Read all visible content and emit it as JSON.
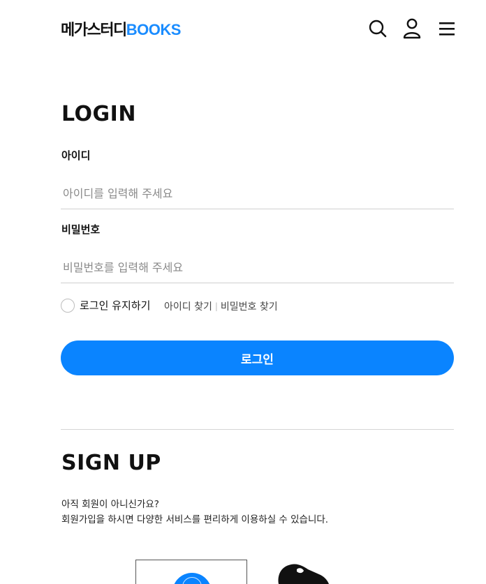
{
  "header": {
    "logo_ko": "메가스터디",
    "logo_en": "BOOKS",
    "icons": [
      "search-icon",
      "user-icon",
      "menu-icon"
    ]
  },
  "login": {
    "title": "LOGIN",
    "id_label": "아이디",
    "id_placeholder": "아이디를 입력해 주세요",
    "pw_label": "비밀번호",
    "pw_placeholder": "비밀번호를 입력해 주세요",
    "remember_label": "로그인 유지하기",
    "find_id": "아이디 찾기",
    "separator": "|",
    "find_pw": "비밀번호 찾기",
    "button": "로그인"
  },
  "signup": {
    "title": "SIGN UP",
    "line1": "아직 회원이 아니신가요?",
    "line2": "회원가입을 하시면 다양한 서비스를 편리하게 이용하실 수 있습니다."
  },
  "colors": {
    "accent": "#0a84ff",
    "logo_blue": "#1a8cff",
    "text": "#111111",
    "placeholder": "#8a8a8a",
    "divider": "#d5d5d5"
  }
}
